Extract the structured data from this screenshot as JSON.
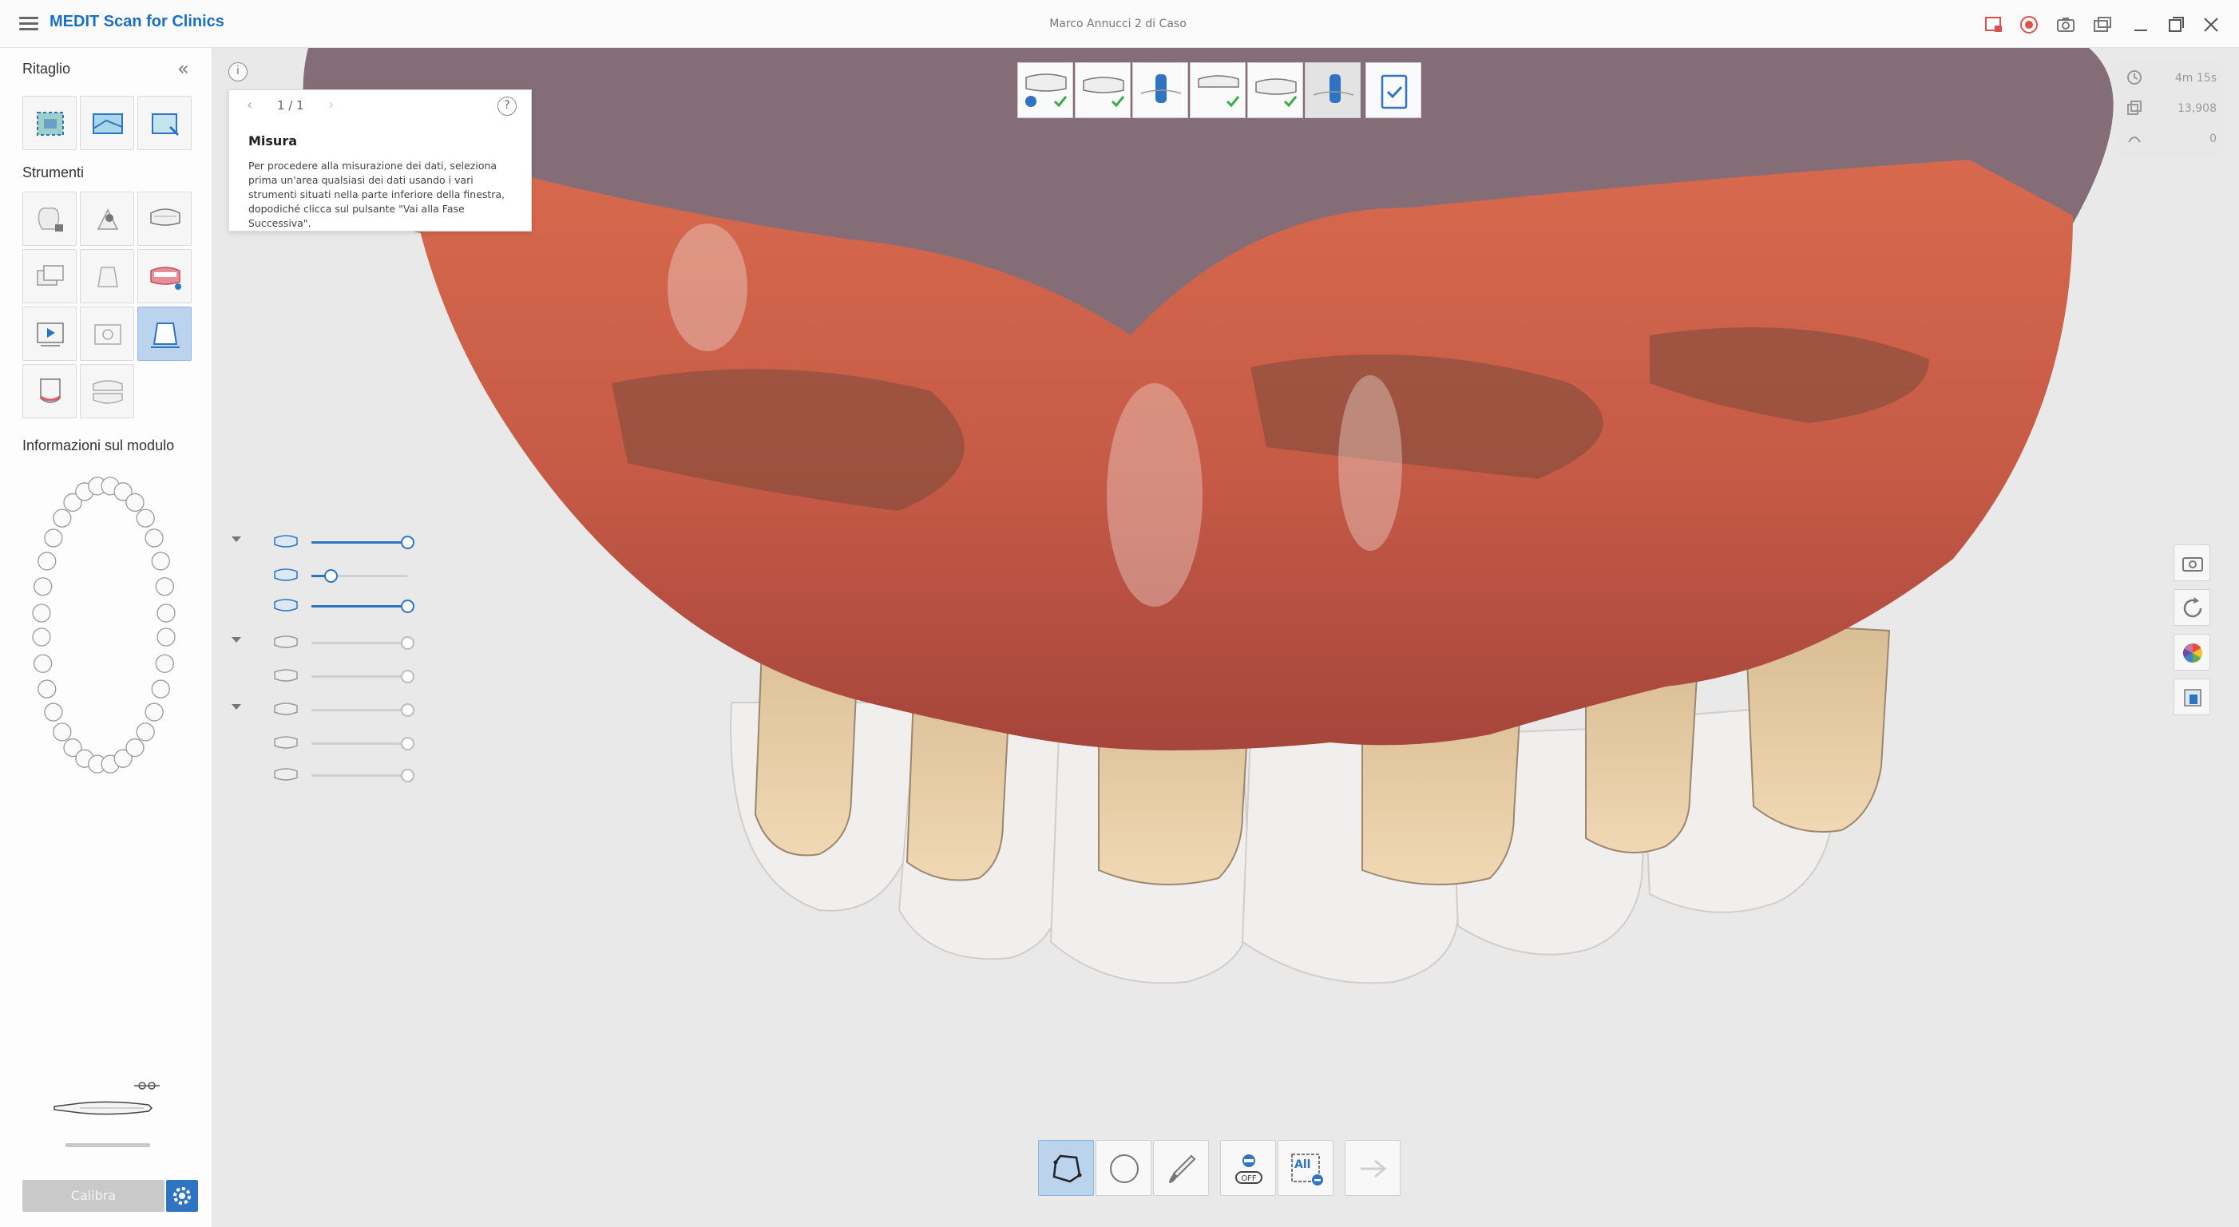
{
  "app": {
    "title": "MEDIT Scan for Clinics",
    "case_title": "Marco Annucci 2 di Caso"
  },
  "left_panel": {
    "section_crop": "Ritaglio",
    "section_tools": "Strumenti",
    "section_info": "Informazioni sul modulo",
    "calibrate_label": "Calibra"
  },
  "popover": {
    "page": "1 / 1",
    "title": "Misura",
    "text": "Per procedere alla misurazione dei dati, seleziona prima un'area qualsiasi dei dati usando i vari strumenti situati nella parte inferiore della finestra, dopodiché clicca sul pulsante \"Vai alla Fase Successiva\"."
  },
  "stats": {
    "time": "4m 15s",
    "count": "13,908",
    "other": "0"
  },
  "sliders": [
    {
      "value": 1.0,
      "on": true
    },
    {
      "value": 0.2,
      "on": true
    },
    {
      "value": 1.0,
      "on": true
    },
    {
      "value": 1.0,
      "on": false
    },
    {
      "value": 1.0,
      "on": false
    },
    {
      "value": 1.0,
      "on": false
    },
    {
      "value": 1.0,
      "on": false
    },
    {
      "value": 1.0,
      "on": false
    }
  ],
  "bottom_toolbar": {
    "all_label": "All"
  },
  "colors": {
    "accent": "#2f73c3",
    "active_tool": "#bcd3ee",
    "viewport_bg": "#e9e9e9"
  },
  "icons": {
    "menu": "hamburger-icon",
    "info": "info-icon",
    "help": "help-icon",
    "settings": "gear-icon"
  }
}
